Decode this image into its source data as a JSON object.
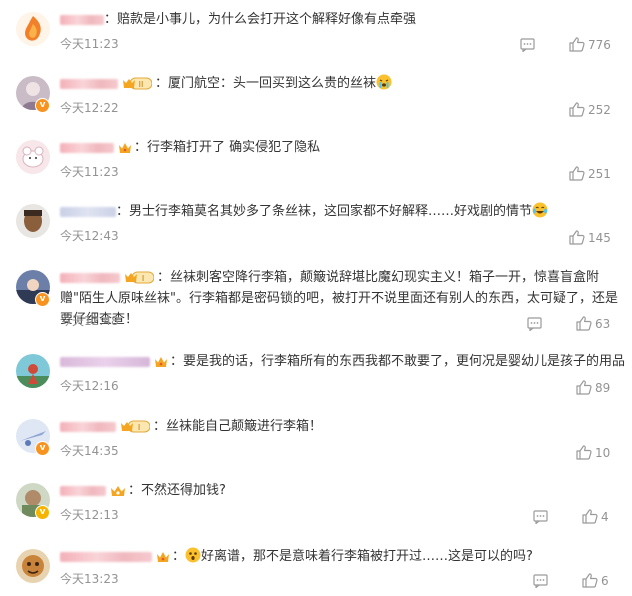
{
  "comments": [
    {
      "username": "",
      "text": "赔款是小事儿，为什么会打开这个解释好像有点牵强",
      "time": "今天11:23",
      "likes": "776",
      "badge": "none",
      "vip": "none"
    },
    {
      "username": "",
      "text": "厦门航空：头一回买到这么贵的丝袜",
      "time": "今天12:22",
      "likes": "252",
      "badge": "crown-level",
      "vip": "orange"
    },
    {
      "username": "",
      "text": "行李箱打开了 确实侵犯了隐私",
      "time": "今天11:23",
      "likes": "251",
      "badge": "crown",
      "vip": "none"
    },
    {
      "username": "",
      "text": "男士行李箱莫名其妙多了条丝袜，这回家都不好解释……好戏剧的情节",
      "time": "今天12:43",
      "likes": "145",
      "badge": "none",
      "vip": "none"
    },
    {
      "username": "",
      "text": "丝袜刺客空降行李箱，颠簸说辞堪比魔幻现实主义！箱子一开，惊喜盲盒附赠\"陌生人原味丝袜\"。行李箱都是密码锁的吧，被打开不说里面还有别人的东西，太可疑了，还是要仔细查查！",
      "time": "今天12:48",
      "likes": "63",
      "badge": "crown-level",
      "vip": "orange"
    },
    {
      "username": "",
      "text": "要是我的话，行李箱所有的东西我都不敢要了，更何况是婴幼儿是孩子的用品",
      "time": "今天12:16",
      "likes": "89",
      "badge": "crown",
      "vip": "none"
    },
    {
      "username": "",
      "text": "丝袜能自己颠簸进行李箱！",
      "time": "今天14:35",
      "likes": "10",
      "badge": "crown-level",
      "vip": "orange"
    },
    {
      "username": "",
      "text": "不然还得加钱?",
      "time": "今天12:13",
      "likes": "4",
      "badge": "crown",
      "vip": "yellow"
    },
    {
      "username": "",
      "text": "好离谱，那不是意味着行李箱被打开过……这是可以的吗?",
      "time": "今天13:23",
      "likes": "6",
      "badge": "crown",
      "vip": "none"
    }
  ],
  "emoji_names": [
    "cry-emoji",
    "laugh-cry-emoji",
    "surprised-emoji"
  ],
  "colors": {
    "text": "#333333",
    "meta": "#939393",
    "vip_orange": "#f7931e",
    "crown": "#f4a623"
  }
}
